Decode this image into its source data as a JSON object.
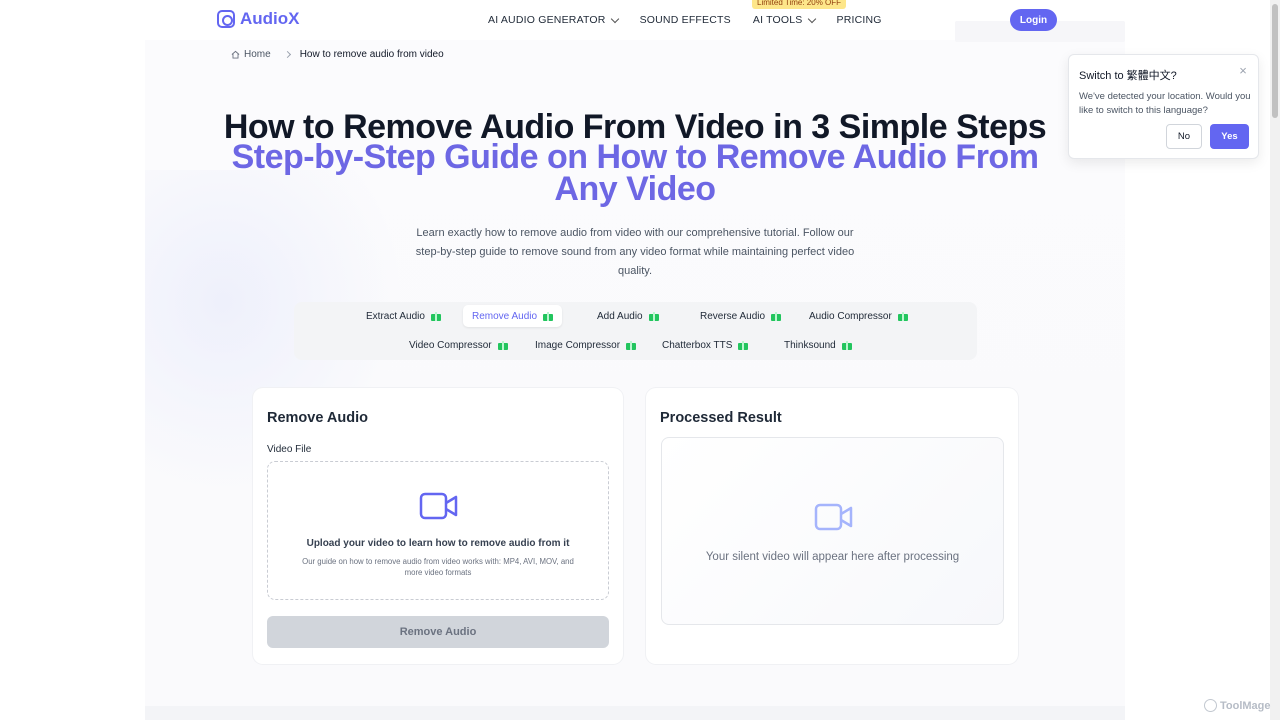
{
  "header": {
    "logo_text": "AudioX",
    "nav": [
      {
        "label": "AI AUDIO GENERATOR",
        "has_dropdown": true
      },
      {
        "label": "SOUND EFFECTS",
        "has_dropdown": false
      },
      {
        "label": "AI TOOLS",
        "has_dropdown": true
      },
      {
        "label": "PRICING",
        "has_dropdown": false
      }
    ],
    "promo_badge": "Limited Time: 20% OFF",
    "login_label": "Login"
  },
  "breadcrumb": {
    "home": "Home",
    "current": "How to remove audio from video"
  },
  "hero": {
    "title": "How to Remove Audio From Video in 3 Simple Steps",
    "subtitle": "Step-by-Step Guide on How to Remove Audio From Any Video",
    "description": "Learn exactly how to remove audio from video with our comprehensive tutorial. Follow our step-by-step guide to remove sound from any video format while maintaining perfect video quality."
  },
  "tools": {
    "row1": [
      "Extract Audio",
      "Remove Audio",
      "Add Audio",
      "Reverse Audio",
      "Audio Compressor"
    ],
    "row2": [
      "Video Compressor",
      "Image Compressor",
      "Chatterbox TTS",
      "Thinksound"
    ],
    "active": "Remove Audio",
    "icon": "gift-icon"
  },
  "upload_card": {
    "title": "Remove Audio",
    "field_label": "Video File",
    "dropzone_title": "Upload your video to learn how to remove audio from it",
    "dropzone_sub": "Our guide on how to remove audio from video works with: MP4, AVI, MOV, and more video formats",
    "button_label": "Remove Audio",
    "icon": "video-camera-icon"
  },
  "result_card": {
    "title": "Processed Result",
    "placeholder": "Your silent video will appear here after processing",
    "icon": "video-camera-icon"
  },
  "language_popup": {
    "title": "Switch to 繁體中文?",
    "body": "We've detected your location. Would you like to switch to this language?",
    "no_label": "No",
    "yes_label": "Yes"
  },
  "watermark": "ToolMage",
  "colors": {
    "accent": "#6366f1",
    "subtitle": "#6d67e4",
    "gift": "#22c55e",
    "promo_bg": "#fde68a"
  }
}
